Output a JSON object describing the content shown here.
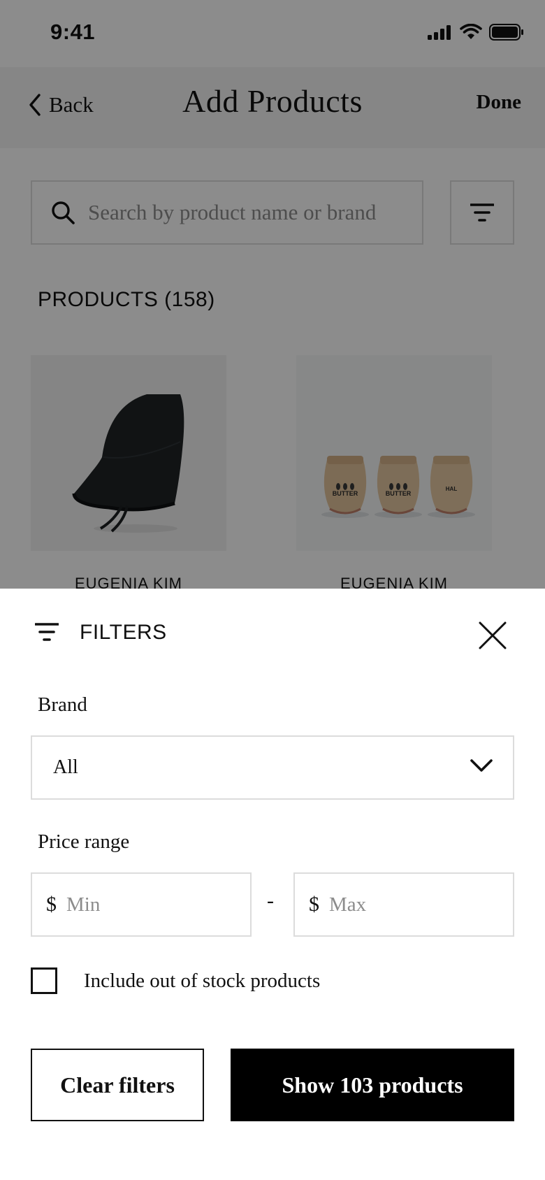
{
  "status_bar": {
    "time": "9:41"
  },
  "navbar": {
    "back_label": "Back",
    "title": "Add Products",
    "done_label": "Done"
  },
  "search": {
    "placeholder": "Search by product name or brand"
  },
  "products": {
    "heading": "PRODUCTS (158)",
    "items": [
      {
        "brand": "EUGENIA KIM",
        "image": "dark-bucket-hat"
      },
      {
        "brand": "EUGENIA KIM",
        "image": "butter-jars",
        "jar_labels": [
          "BUTTER",
          "BUTTER",
          "HAL"
        ]
      }
    ]
  },
  "filters": {
    "title": "FILTERS",
    "brand": {
      "label": "Brand",
      "value": "All"
    },
    "price": {
      "label": "Price range",
      "currency": "$",
      "min_placeholder": "Min",
      "max_placeholder": "Max",
      "separator": "-"
    },
    "out_of_stock": {
      "label": "Include out of stock products",
      "checked": false
    },
    "clear_label": "Clear filters",
    "show_label": "Show 103 products"
  },
  "colors": {
    "accent": "#000000",
    "border": "#dcdcdc",
    "overlay": "rgba(0,0,0,0.45)",
    "placeholder": "#8c8c8c"
  }
}
